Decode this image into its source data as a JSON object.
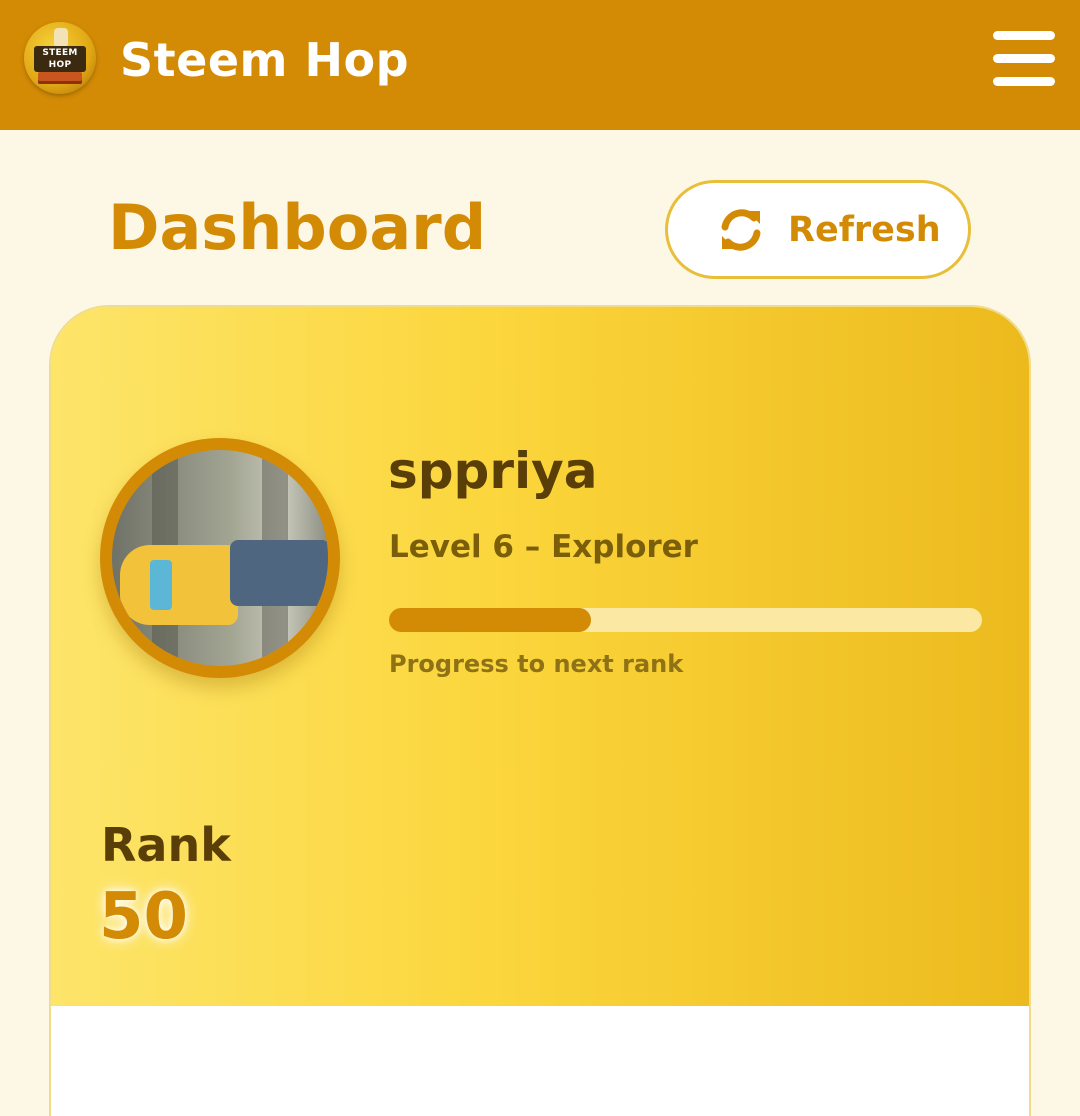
{
  "header": {
    "logo_text": "STEEM HOP",
    "title": "Steem Hop",
    "menu_icon": "hamburger-menu-icon"
  },
  "page": {
    "title": "Dashboard",
    "refresh_label": "Refresh",
    "refresh_icon": "refresh-icon"
  },
  "profile": {
    "username": "sppriya",
    "level_text": "Level 6 – Explorer",
    "progress_percent": 34,
    "progress_label": "Progress to next rank",
    "rank_label": "Rank",
    "rank_value": "50"
  },
  "colors": {
    "brand": "#d38b05",
    "background": "#fdf8e6",
    "card_gradient_start": "#fde56a",
    "card_gradient_end": "#ecba1d",
    "text_dark": "#5a3e08"
  }
}
